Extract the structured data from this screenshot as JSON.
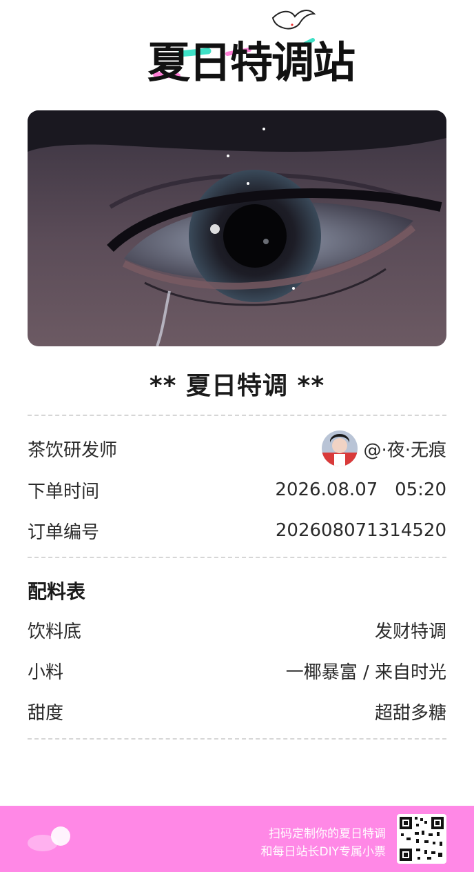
{
  "header": {
    "logo_text": "夏日特调站",
    "logo_icon": "seagull-icon"
  },
  "hero": {
    "image": "closeup-eye-photo"
  },
  "receipt": {
    "title": "** 夏日特调 **",
    "info_rows": [
      {
        "label": "茶饮研发师",
        "value": "@·夜·无痕"
      },
      {
        "label": "下单时间",
        "value": "2026.08.07   05:20"
      },
      {
        "label": "订单编号",
        "value": "202608071314520"
      }
    ],
    "ingredients": {
      "heading": "配料表",
      "rows": [
        {
          "label": "饮料底",
          "value": "发财特调"
        },
        {
          "label": "小料",
          "value": "一椰暴富 / 来自时光"
        },
        {
          "label": "甜度",
          "value": "超甜多糖"
        }
      ]
    }
  },
  "footer": {
    "line1": "扫码定制你的夏日特调",
    "line2": "和每日站长DIY专属小票",
    "qr_icon": "qr-code-icon",
    "background": "#ff88e6"
  },
  "colors": {
    "accent_green": "#3ee0c6",
    "accent_pink": "#ff7fd6",
    "text": "#1e1e1e",
    "divider": "#d6d6d6"
  }
}
